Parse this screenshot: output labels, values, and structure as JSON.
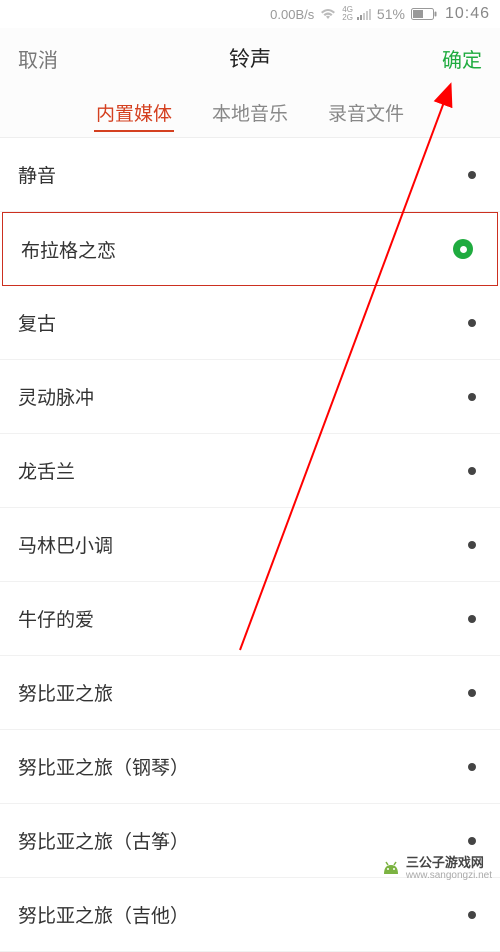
{
  "status": {
    "speed": "0.00B/s",
    "signal_top": "4G",
    "signal_bottom": "2G",
    "battery_pct": "51%",
    "time": "10:46"
  },
  "nav": {
    "cancel": "取消",
    "title": "铃声",
    "confirm": "确定"
  },
  "tabs": {
    "t0": "内置媒体",
    "t1": "本地音乐",
    "t2": "录音文件"
  },
  "list": {
    "i0": "静音",
    "i1": "布拉格之恋",
    "i2": "复古",
    "i3": "灵动脉冲",
    "i4": "龙舌兰",
    "i5": "马林巴小调",
    "i6": "牛仔的爱",
    "i7": "努比亚之旅",
    "i8": "努比亚之旅（钢琴）",
    "i9": "努比亚之旅（古筝）",
    "i10": "努比亚之旅（吉他）"
  },
  "watermark": {
    "site": "三公子游戏网",
    "url": "www.sangongzi.net"
  }
}
